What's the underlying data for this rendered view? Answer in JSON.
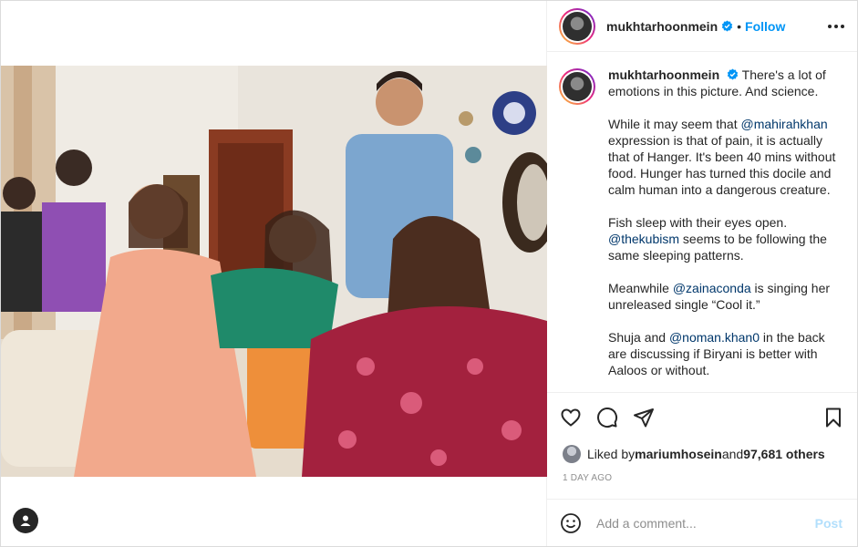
{
  "header": {
    "username": "mukhtarhoonmein",
    "separator": "•",
    "follow_label": "Follow"
  },
  "caption": {
    "username": "mukhtarhoonmein",
    "p1": "There's a lot of emotions in this picture. And science.",
    "p2_a": "While it may seem that ",
    "p2_mention": "@mahirahkhan",
    "p2_b": " expression is that of pain, it is actually that of Hanger. It's been 40 mins without food. Hunger has turned this docile and calm human into a dangerous creature.",
    "p3_a": "Fish sleep with their eyes open. ",
    "p3_mention": "@thekubism",
    "p3_b": " seems to be following the same sleeping patterns.",
    "p4_a": "Meanwhile ",
    "p4_mention": "@zainaconda",
    "p4_b": " is singing her unreleased single “Cool it.”",
    "p5_a": "Shuja and ",
    "p5_mention": "@noman.khan0",
    "p5_b": " in the back are discussing if Biryani is better with Aaloos or without."
  },
  "likes": {
    "prefix": "Liked by ",
    "user": "mariumhosein",
    "middle": " and ",
    "count": "97,681 others"
  },
  "timestamp": "1 DAY AGO",
  "comment": {
    "placeholder": "Add a comment...",
    "post_label": "Post"
  },
  "icons": {
    "like": "heart-icon",
    "comment": "comment-icon",
    "share": "paper-plane-icon",
    "save": "bookmark-icon",
    "emoji": "emoji-icon",
    "tags": "user-tag-icon",
    "verified": "verified-badge-icon",
    "more": "more-options-icon"
  },
  "colors": {
    "accent": "#0095f6",
    "mention": "#00376b",
    "muted": "#8e8e8e",
    "post_disabled": "#b2dffc"
  }
}
